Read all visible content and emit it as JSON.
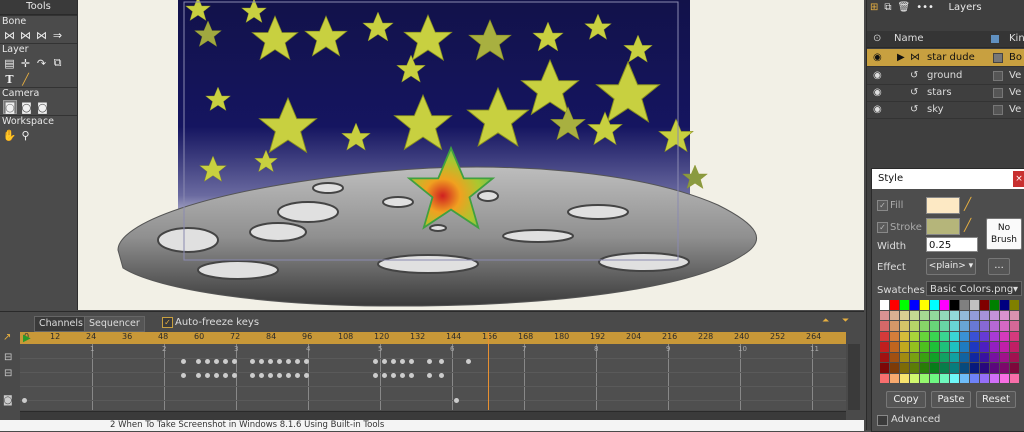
{
  "tools": {
    "title": "Tools",
    "bone_label": "Bone",
    "layer_label": "Layer",
    "camera_label": "Camera",
    "workspace_label": "Workspace"
  },
  "layers_panel": {
    "title": "Layers",
    "col_name": "Name",
    "col_kind": "Kin",
    "rows": [
      {
        "name": "star dude",
        "kind": "Bo",
        "selected": true
      },
      {
        "name": "ground",
        "kind": "Ve"
      },
      {
        "name": "stars",
        "kind": "Ve"
      },
      {
        "name": "sky",
        "kind": "Ve"
      }
    ]
  },
  "style_panel": {
    "title": "Style",
    "fill_label": "Fill",
    "stroke_label": "Stroke",
    "no_brush_label": "No\nBrush",
    "width_label": "Width",
    "width_value": "0.25",
    "effect_label": "Effect",
    "effect_value": "<plain>",
    "effect_more": "...",
    "swatches_label": "Swatches",
    "swatches_value": "Basic Colors.png",
    "copy_label": "Copy",
    "paste_label": "Paste",
    "reset_label": "Reset",
    "advanced_label": "Advanced",
    "fill_color": "#fde9c4",
    "stroke_color": "#b5b57a"
  },
  "timeline": {
    "tab_channels": "Channels",
    "tab_sequencer": "Sequencer",
    "autofreeze_label": "Auto-freeze keys",
    "ruler_start": "0",
    "ruler_labels": [
      "12",
      "24",
      "36",
      "48",
      "60",
      "72",
      "84",
      "96",
      "108",
      "120",
      "132",
      "144",
      "156",
      "168",
      "180",
      "192",
      "204",
      "216",
      "228",
      "240",
      "252",
      "264"
    ],
    "current_frame": 156,
    "sub_labels": [
      "1",
      "2",
      "3",
      "4",
      "5",
      "6",
      "7",
      "8",
      "9",
      "10",
      "11"
    ]
  },
  "status_fragment": "2 When To Take Screenshot in Windows 8.1.6 Using Built-in Tools"
}
